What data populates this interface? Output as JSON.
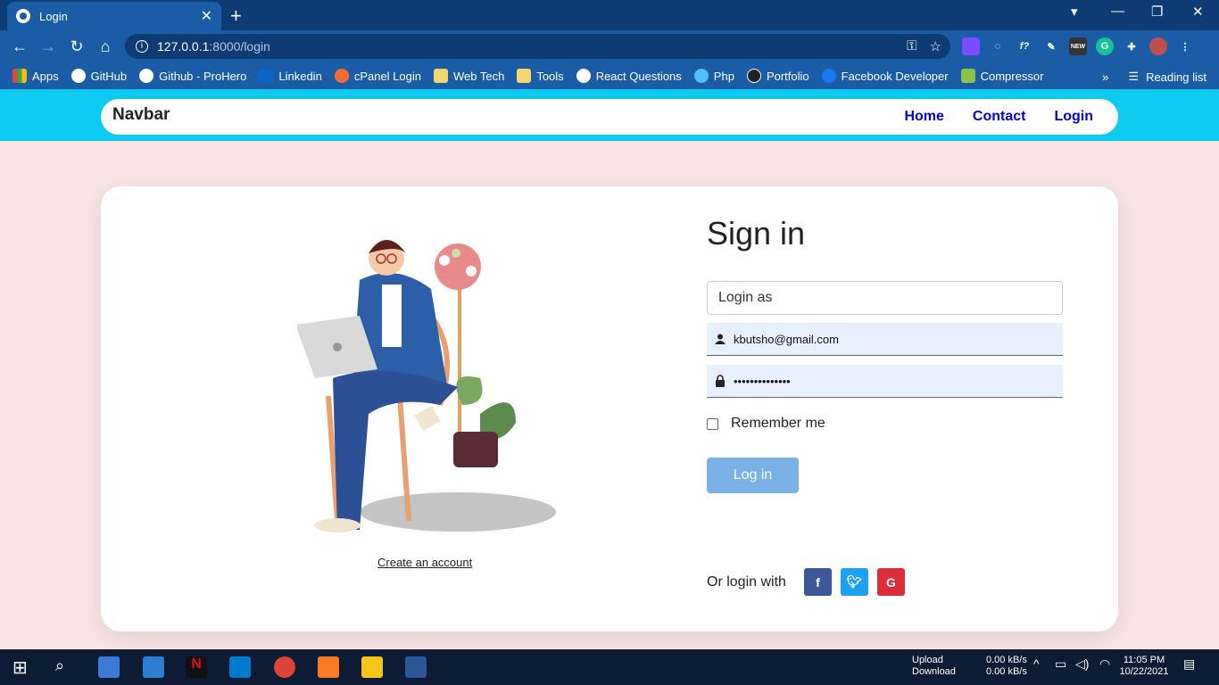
{
  "browser": {
    "tab_title": "Login",
    "url_host": "127.0.0.1",
    "url_path": ":8000/login",
    "bookmarks": [
      {
        "label": "Apps",
        "color": "#e8453c"
      },
      {
        "label": "GitHub",
        "color": "#ffffff"
      },
      {
        "label": "Github - ProHero",
        "color": "#ffffff"
      },
      {
        "label": "Linkedin",
        "color": "#0a66c2"
      },
      {
        "label": "cPanel Login",
        "color": "#ff6c2c"
      },
      {
        "label": "Web Tech",
        "color": "#f5d76e"
      },
      {
        "label": "Tools",
        "color": "#f5d76e"
      },
      {
        "label": "React Questions",
        "color": "#ffffff"
      },
      {
        "label": "Php",
        "color": "#4fc3f7"
      },
      {
        "label": "Portfolio",
        "color": "#222222"
      },
      {
        "label": "Facebook Developer",
        "color": "#1877f2"
      },
      {
        "label": "Compressor",
        "color": "#8bc34a"
      }
    ],
    "reading_list": "Reading list"
  },
  "navbar": {
    "brand": "Navbar",
    "links": [
      "Home",
      "Contact",
      "Login"
    ]
  },
  "login": {
    "title": "Sign in",
    "login_as": "Login as",
    "email": "kbutsho@gmail.com",
    "password_mask": "••••••••••••••",
    "remember": "Remember me",
    "button": "Log in",
    "create_account": "Create an account",
    "or_login_with": "Or login with",
    "social": [
      {
        "glyph": "f",
        "color": "#3b5998"
      },
      {
        "glyph": "t",
        "color": "#1da1f2"
      },
      {
        "glyph": "G",
        "color": "#dd2c3a"
      }
    ]
  },
  "taskbar": {
    "upload": "Upload",
    "download": "Download",
    "up_rate": "0.00 kB/s",
    "down_rate": "0.00 kB/s",
    "time": "11:05 PM",
    "date": "10/22/2021"
  },
  "colors": {
    "nav_band": "#0ccaf0",
    "page_bg": "#f6e4e4",
    "link_blue": "#0000cc",
    "button": "#7bb1e6"
  }
}
